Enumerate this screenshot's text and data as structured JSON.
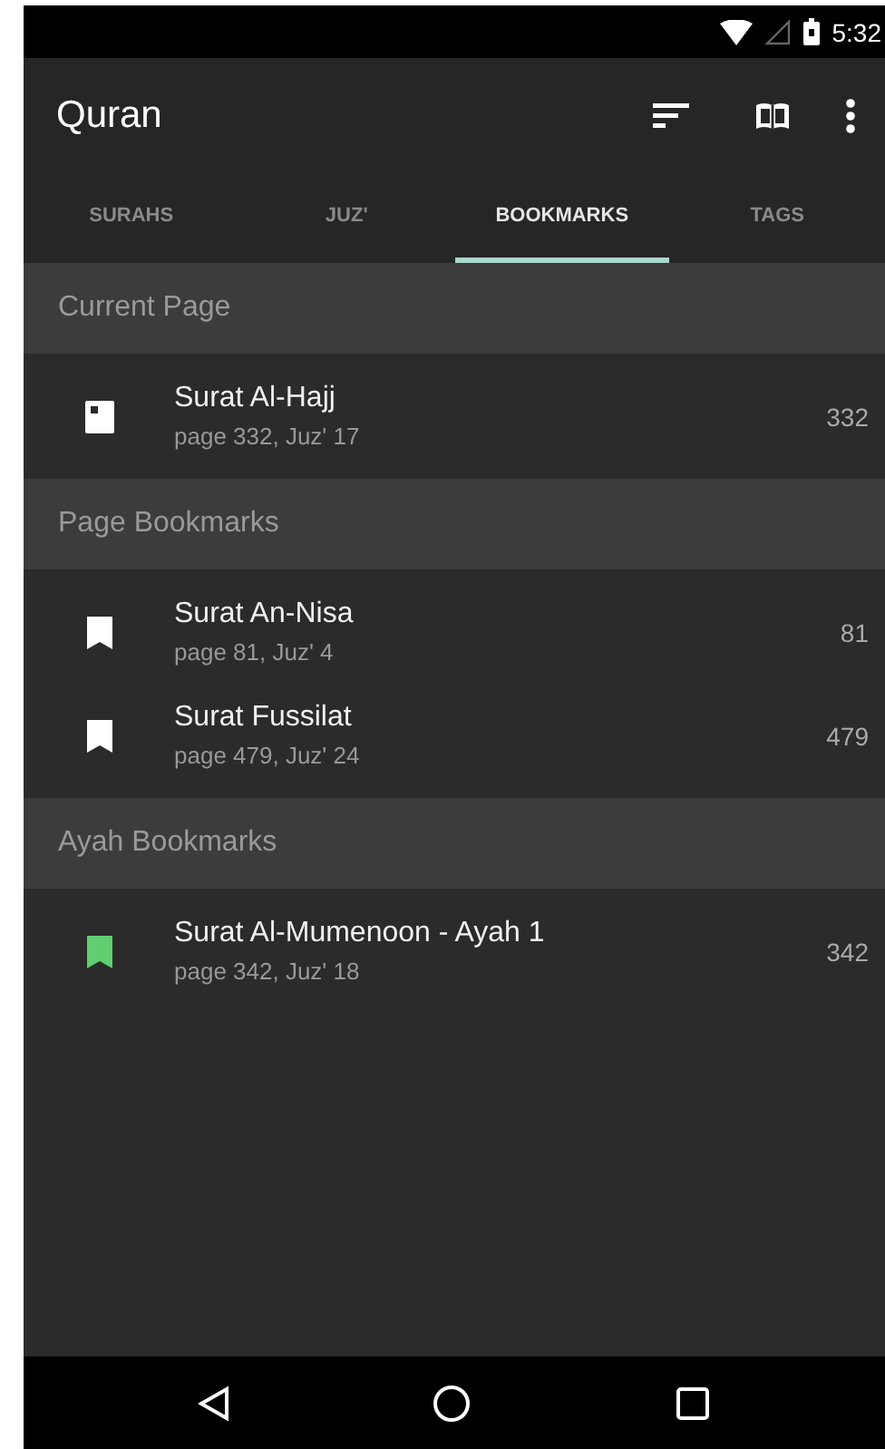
{
  "status_bar": {
    "time": "5:32"
  },
  "toolbar": {
    "title": "Quran"
  },
  "tabs": [
    {
      "label": "SURAHS",
      "selected": false
    },
    {
      "label": "JUZ'",
      "selected": false
    },
    {
      "label": "BOOKMARKS",
      "selected": true
    },
    {
      "label": "TAGS",
      "selected": false
    }
  ],
  "sections": [
    {
      "title": "Current Page",
      "items": [
        {
          "kind": "current",
          "title": "Surat Al-Hajj",
          "subtitle": "page 332, Juz' 17",
          "page": "332"
        }
      ]
    },
    {
      "title": "Page Bookmarks",
      "items": [
        {
          "kind": "page",
          "title": "Surat An-Nisa",
          "subtitle": "page 81, Juz' 4",
          "page": "81"
        },
        {
          "kind": "page",
          "title": "Surat Fussilat",
          "subtitle": "page 479, Juz' 24",
          "page": "479"
        }
      ]
    },
    {
      "title": "Ayah Bookmarks",
      "items": [
        {
          "kind": "ayah",
          "title": "Surat Al-Mumenoon - Ayah 1",
          "subtitle": "page 342, Juz' 18",
          "page": "342"
        }
      ]
    }
  ]
}
